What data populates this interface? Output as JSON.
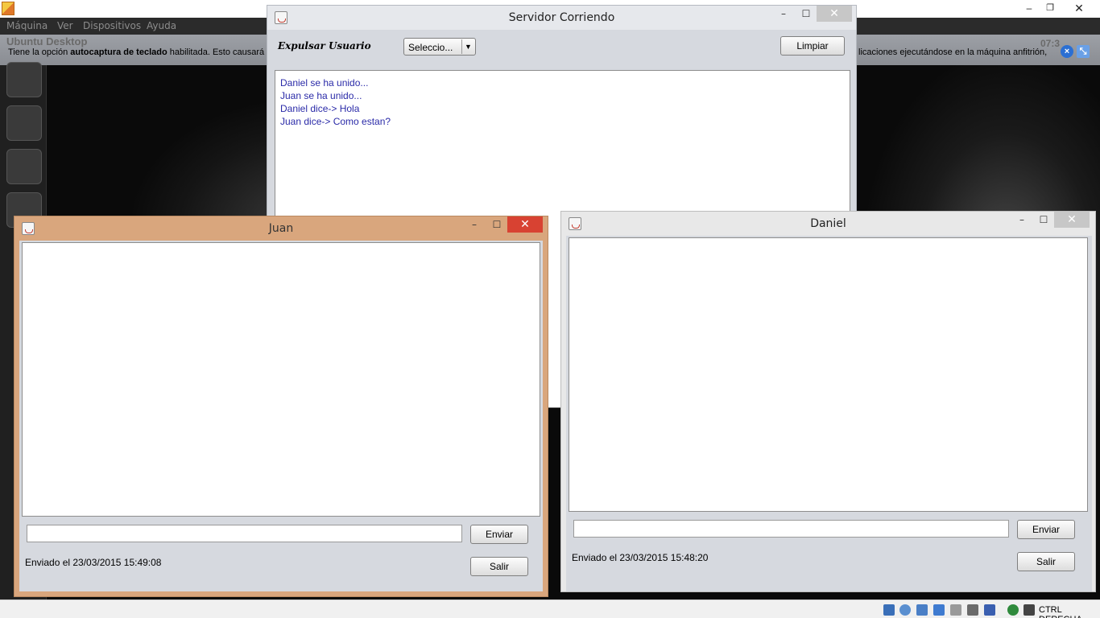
{
  "host": {
    "menu": [
      "Máquina",
      "Ver",
      "Dispositivos",
      "Ayuda"
    ],
    "info_text_prefix": "Tiene la opción ",
    "info_text_bold": "autocaptura de teclado",
    "info_text_suffix": " habilitada. Esto causará",
    "info_text_right": "licaciones ejecutándose en la máquina anfitrión,",
    "ubuntu_label": "Ubuntu Desktop",
    "clock": "07:3",
    "hostkey_label": "CTRL DERECHA",
    "controls": {
      "minimize": "–",
      "restore": "❐",
      "close": "✕"
    }
  },
  "server_window": {
    "title": "Servidor Corriendo",
    "expulsar_label": "Expulsar Usuario",
    "select_value": "Seleccio...",
    "clear_button": "Limpiar",
    "log": [
      "Daniel se ha unido...",
      "Juan se ha unido...",
      "Daniel dice-> Hola",
      "Juan dice->  Como estan?"
    ]
  },
  "juan_window": {
    "title": "Juan",
    "input_value": "",
    "send_button": "Enviar",
    "status": "Enviado el 23/03/2015 15:49:08",
    "exit_button": "Salir"
  },
  "daniel_window": {
    "title": "Daniel",
    "input_value": "",
    "send_button": "Enviar",
    "status": "Enviado el 23/03/2015 15:48:20",
    "exit_button": "Salir"
  },
  "window_controls": {
    "minimize": "–",
    "maximize": "☐",
    "close": "✕"
  },
  "colors": {
    "juan_frame": "#d9a67d",
    "close_active": "#d84232",
    "log_text": "#2a2aa8"
  }
}
